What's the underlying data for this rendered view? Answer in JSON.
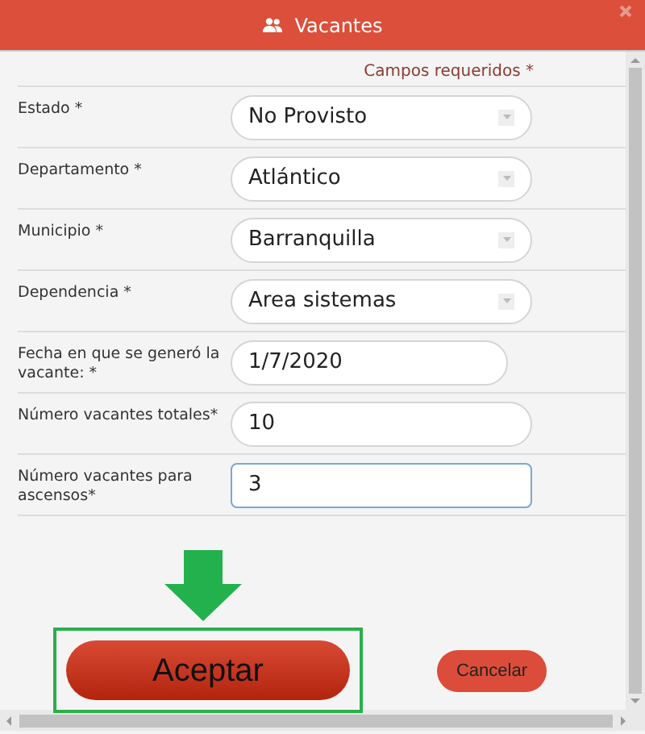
{
  "window": {
    "title": "Vacantes"
  },
  "required_note": "Campos requeridos *",
  "fields": [
    {
      "label": "Estado *",
      "kind": "select",
      "value": "No Provisto",
      "focused": false
    },
    {
      "label": "Departamento *",
      "kind": "select",
      "value": "Atlántico",
      "focused": false
    },
    {
      "label": "Municipio *",
      "kind": "select",
      "value": "Barranquilla",
      "focused": false
    },
    {
      "label": "Dependencia *",
      "kind": "select",
      "value": "Area sistemas",
      "focused": false
    },
    {
      "label": "Fecha en que se generó la vacante: *",
      "kind": "date",
      "value": "1/7/2020",
      "focused": false
    },
    {
      "label": "Número vacantes totales*",
      "kind": "text",
      "value": "10",
      "focused": false
    },
    {
      "label": "Número vacantes para ascensos*",
      "kind": "text",
      "value": "3",
      "focused": true
    }
  ],
  "buttons": [
    {
      "label": "Aceptar",
      "kind": "primary",
      "highlighted": true
    },
    {
      "label": "Cancelar",
      "kind": "secondary",
      "highlighted": false
    }
  ]
}
